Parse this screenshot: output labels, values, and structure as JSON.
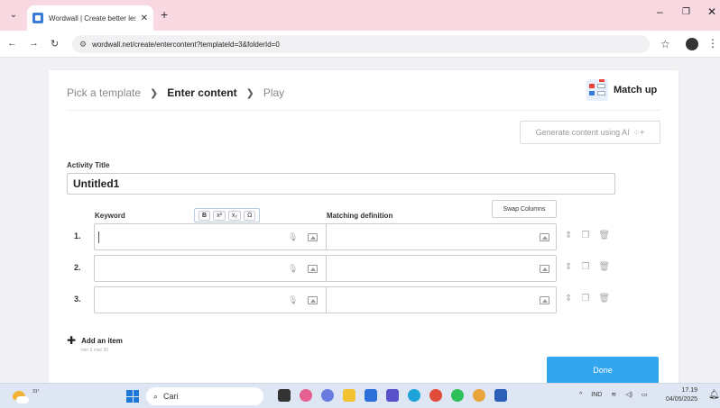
{
  "browser": {
    "tab_title": "Wordwall | Create better lessons",
    "url": "wordwall.net/create/entercontent?templateId=3&folderId=0"
  },
  "steps": {
    "pick": "Pick a template",
    "enter": "Enter content",
    "play": "Play"
  },
  "template": {
    "name": "Match up"
  },
  "gen_ai_label": "Generate content using AI",
  "activity": {
    "label": "Activity Title",
    "value": "Untitled1"
  },
  "columns": {
    "keyword": "Keyword",
    "definition": "Matching definition",
    "swap_label": "Swap Columns"
  },
  "format_buttons": [
    "B",
    "x²",
    "x₂",
    "Ω"
  ],
  "rows": [
    {
      "num": "1.",
      "keyword": "",
      "definition": ""
    },
    {
      "num": "2.",
      "keyword": "",
      "definition": ""
    },
    {
      "num": "3.",
      "keyword": "",
      "definition": ""
    }
  ],
  "add_item": {
    "label": "Add an item",
    "limits": "min 3   max 30"
  },
  "done_label": "Done",
  "taskbar": {
    "temp": "31°",
    "search": "Cari",
    "lang": "IND",
    "time": "17.19",
    "date": "04/05/2025"
  },
  "colors": {
    "done_bg": "#33a6f0",
    "tab_bar": "#f8d9e2",
    "accent": "#3a7bd5"
  }
}
